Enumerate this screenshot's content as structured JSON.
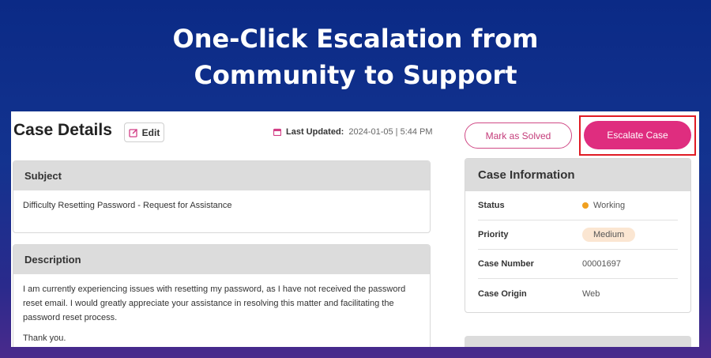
{
  "headline": {
    "line1": "One-Click Escalation from",
    "line2": "Community to Support"
  },
  "header": {
    "title": "Case Details",
    "edit_label": "Edit",
    "last_updated_label": "Last Updated:",
    "last_updated_value": "2024-01-05 | 5:44 PM"
  },
  "subject": {
    "heading": "Subject",
    "text": "Difficulty Resetting Password - Request for Assistance"
  },
  "description": {
    "heading": "Description",
    "paragraph1": "I am currently experiencing issues with resetting my password, as I have not received the password reset email. I would greatly appreciate your assistance in resolving this matter and facilitating the password reset process.",
    "paragraph2": "Thank you."
  },
  "actions": {
    "mark_solved_label": "Mark as Solved",
    "escalate_label": "Escalate Case"
  },
  "case_info": {
    "heading": "Case Information",
    "rows": [
      {
        "key": "Status",
        "value": "Working"
      },
      {
        "key": "Priority",
        "value": "Medium"
      },
      {
        "key": "Case Number",
        "value": "00001697"
      },
      {
        "key": "Case Origin",
        "value": "Web"
      }
    ]
  },
  "colors": {
    "accent": "#df2d7f",
    "highlight_frame": "#e01b24",
    "status_dot": "#f0a020"
  }
}
